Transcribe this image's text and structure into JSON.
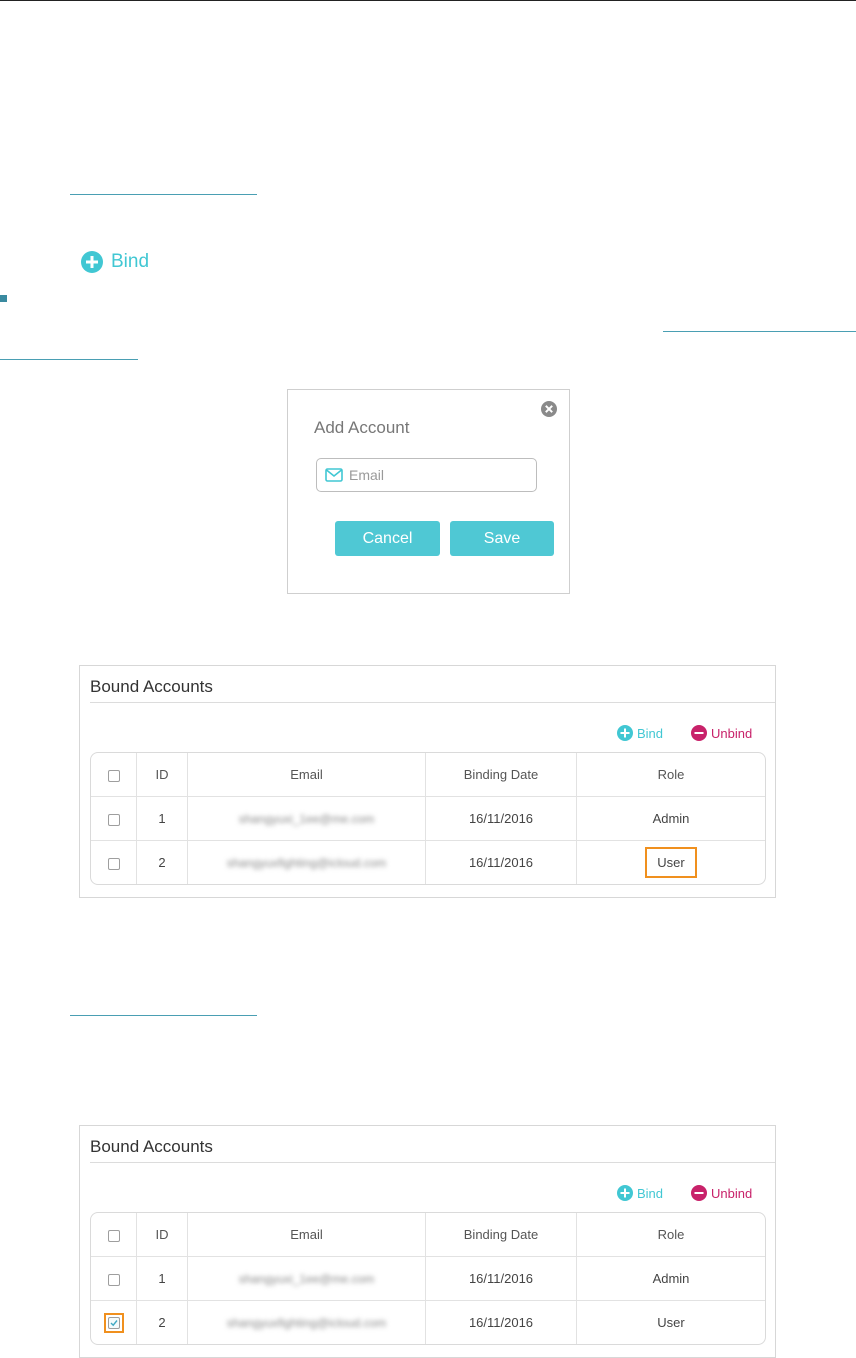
{
  "bind_link": {
    "label": "Bind"
  },
  "dialog": {
    "title": "Add Account",
    "email_placeholder": "Email",
    "cancel": "Cancel",
    "save": "Save"
  },
  "panels": [
    {
      "title": "Bound Accounts",
      "bind": "Bind",
      "unbind": "Unbind",
      "headers": {
        "id": "ID",
        "email": "Email",
        "date": "Binding Date",
        "role": "Role"
      },
      "rows": [
        {
          "id": "1",
          "email": "shangyuxi_1ee@me.com",
          "date": "16/11/2016",
          "role": "Admin",
          "checked": false
        },
        {
          "id": "2",
          "email": "shangyuxfighting@icloud.com",
          "date": "16/11/2016",
          "role": "User",
          "checked": false
        }
      ]
    },
    {
      "title": "Bound Accounts",
      "bind": "Bind",
      "unbind": "Unbind",
      "headers": {
        "id": "ID",
        "email": "Email",
        "date": "Binding Date",
        "role": "Role"
      },
      "rows": [
        {
          "id": "1",
          "email": "shangyuxi_1ee@me.com",
          "date": "16/11/2016",
          "role": "Admin",
          "checked": false
        },
        {
          "id": "2",
          "email": "shangyuxfighting@icloud.com",
          "date": "16/11/2016",
          "role": "User",
          "checked": true
        }
      ]
    }
  ],
  "colors": {
    "accent": "#4fc8d4",
    "unbind": "#c8226a",
    "highlight": "#f0901e",
    "link_underline": "#4a9fb3"
  }
}
